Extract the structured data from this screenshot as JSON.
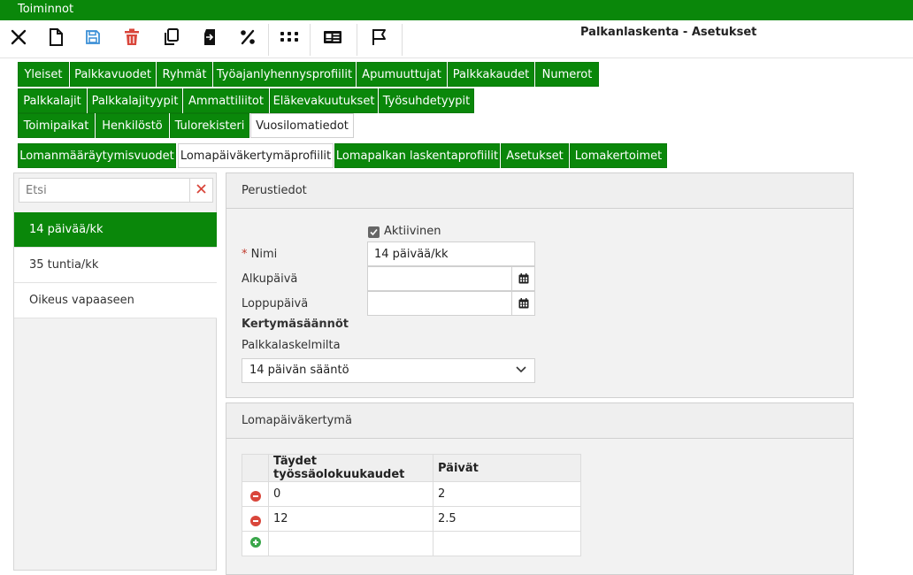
{
  "menubar": {
    "label": "Toiminnot"
  },
  "header": {
    "title": "Palkanlaskenta - Asetukset"
  },
  "toolbar": {
    "buttons": [
      {
        "icon": "close-icon",
        "color": "#111111"
      },
      {
        "icon": "new-document-icon",
        "color": "#111111"
      },
      {
        "icon": "save-icon",
        "color": "#3a8fd6"
      },
      {
        "icon": "delete-icon",
        "color": "#d9463b"
      },
      {
        "icon": "copy-icon",
        "color": "#111111"
      },
      {
        "icon": "transfer-icon",
        "color": "#111111"
      },
      {
        "icon": "percent-icon",
        "color": "#111111"
      },
      {
        "icon": "grid-dots-icon",
        "color": "#111111"
      },
      {
        "icon": "id-card-icon",
        "color": "#111111"
      },
      {
        "icon": "flag-icon",
        "color": "#111111"
      }
    ]
  },
  "tabs": {
    "row1": [
      "Yleiset",
      "Palkkavuodet",
      "Ryhmät",
      "Työajanlyhennysprofiilit",
      "Apumuuttujat",
      "Palkkakaudet",
      "Numerot"
    ],
    "row2": [
      "Palkkalajit",
      "Palkkalajityypit",
      "Ammattiliitot",
      "Eläkevakuutukset",
      "Työsuhdetyypit"
    ],
    "row3": [
      "Toimipaikat",
      "Henkilöstö",
      "Tulorekisteri",
      "Vuosilomatiedot"
    ],
    "row4": [
      "Lomanmääräytymisvuodet",
      "Lomapäiväkertymäprofiilit",
      "Lomapalkan laskentaprofiilit",
      "Asetukset",
      "Lomakertoimet"
    ],
    "active_row3": "Vuosilomatiedot",
    "active_row4": "Lomapäiväkertymäprofiilit"
  },
  "sidebar": {
    "search_placeholder": "Etsi",
    "items": [
      {
        "label": "14 päivää/kk",
        "selected": true
      },
      {
        "label": "35 tuntia/kk",
        "selected": false
      },
      {
        "label": "Oikeus vapaaseen",
        "selected": false
      }
    ]
  },
  "basic": {
    "heading": "Perustiedot",
    "active_label": "Aktiivinen",
    "active_checked": true,
    "name_label": "Nimi",
    "name_value": "14 päivää/kk",
    "start_label": "Alkupäivä",
    "start_value": "",
    "end_label": "Loppupäivä",
    "end_value": "",
    "rules_heading": "Kertymäsäännöt",
    "payslips_label": "Palkkalaskelmilta",
    "rule_value": "14 päivän sääntö"
  },
  "accrual": {
    "heading": "Lomapäiväkertymä",
    "columns": [
      "Täydet työssäolokuukaudet",
      "Päivät"
    ],
    "rows": [
      {
        "months": "0",
        "days": "2"
      },
      {
        "months": "12",
        "days": "2.5"
      }
    ]
  },
  "colors": {
    "brand_green": "#0a870a",
    "remove_red": "#d9463b",
    "add_green": "#3aa64a"
  }
}
